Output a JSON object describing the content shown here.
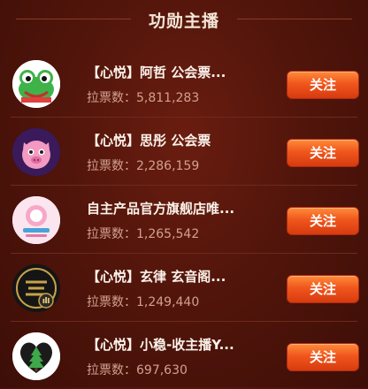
{
  "header": {
    "title": "功勋主播"
  },
  "votes_label": "拉票数：",
  "anchors": [
    {
      "name": "【心悦】阿哲 公会票...",
      "votes": "5,811,283",
      "follow_label": "关注",
      "avatar_icon": "frog-avatar-icon"
    },
    {
      "name": "【心悦】思彤 公会票",
      "votes": "2,286,159",
      "follow_label": "关注",
      "avatar_icon": "pink-pig-avatar-icon"
    },
    {
      "name": "自主产品官方旗舰店唯...",
      "votes": "1,265,542",
      "follow_label": "关注",
      "avatar_icon": "brand-logo-avatar-icon"
    },
    {
      "name": "【心悦】玄律 玄音阁...",
      "votes": "1,249,440",
      "follow_label": "关注",
      "avatar_icon": "dark-emblem-avatar-icon"
    },
    {
      "name": "【心悦】小稳-收主播Y...",
      "votes": "697,630",
      "follow_label": "关注",
      "avatar_icon": "heart-tree-avatar-icon"
    }
  ],
  "colors": {
    "background": "#52150b",
    "button_top": "#ff8c3a",
    "button_bottom": "#d73b0f",
    "votes_text": "#d2a18f"
  }
}
